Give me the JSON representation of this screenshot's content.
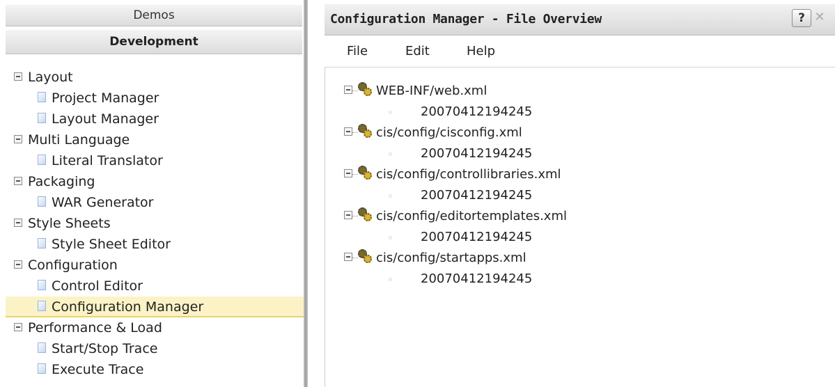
{
  "left_panel": {
    "accordion": {
      "demos": "Demos",
      "development": "Development"
    },
    "tree": [
      {
        "type": "folder",
        "label": "Layout"
      },
      {
        "type": "leaf",
        "label": "Project Manager"
      },
      {
        "type": "leaf",
        "label": "Layout Manager"
      },
      {
        "type": "folder",
        "label": "Multi Language"
      },
      {
        "type": "leaf",
        "label": "Literal Translator"
      },
      {
        "type": "folder",
        "label": "Packaging"
      },
      {
        "type": "leaf",
        "label": "WAR Generator"
      },
      {
        "type": "folder",
        "label": "Style Sheets"
      },
      {
        "type": "leaf",
        "label": "Style Sheet Editor"
      },
      {
        "type": "folder",
        "label": "Configuration"
      },
      {
        "type": "leaf",
        "label": "Control Editor"
      },
      {
        "type": "leaf",
        "label": "Configuration Manager",
        "selected": true
      },
      {
        "type": "folder",
        "label": "Performance & Load"
      },
      {
        "type": "leaf",
        "label": "Start/Stop Trace"
      },
      {
        "type": "leaf",
        "label": "Execute Trace"
      }
    ]
  },
  "window": {
    "title": "Configuration Manager - File Overview",
    "help_label": "?",
    "close_label": "✕",
    "menu": {
      "file": "File",
      "edit": "Edit",
      "help": "Help"
    }
  },
  "files": [
    {
      "name": "WEB-INF/web.xml",
      "timestamp": "20070412194245"
    },
    {
      "name": "cis/config/cisconfig.xml",
      "timestamp": "20070412194245"
    },
    {
      "name": "cis/config/controllibraries.xml",
      "timestamp": "20070412194245"
    },
    {
      "name": "cis/config/editortemplates.xml",
      "timestamp": "20070412194245"
    },
    {
      "name": "cis/config/startapps.xml",
      "timestamp": "20070412194245"
    }
  ],
  "colors": {
    "selection_bg": "#fbf3c6",
    "selection_border": "#e7d36a",
    "header_bg": "#e4e4e4"
  }
}
